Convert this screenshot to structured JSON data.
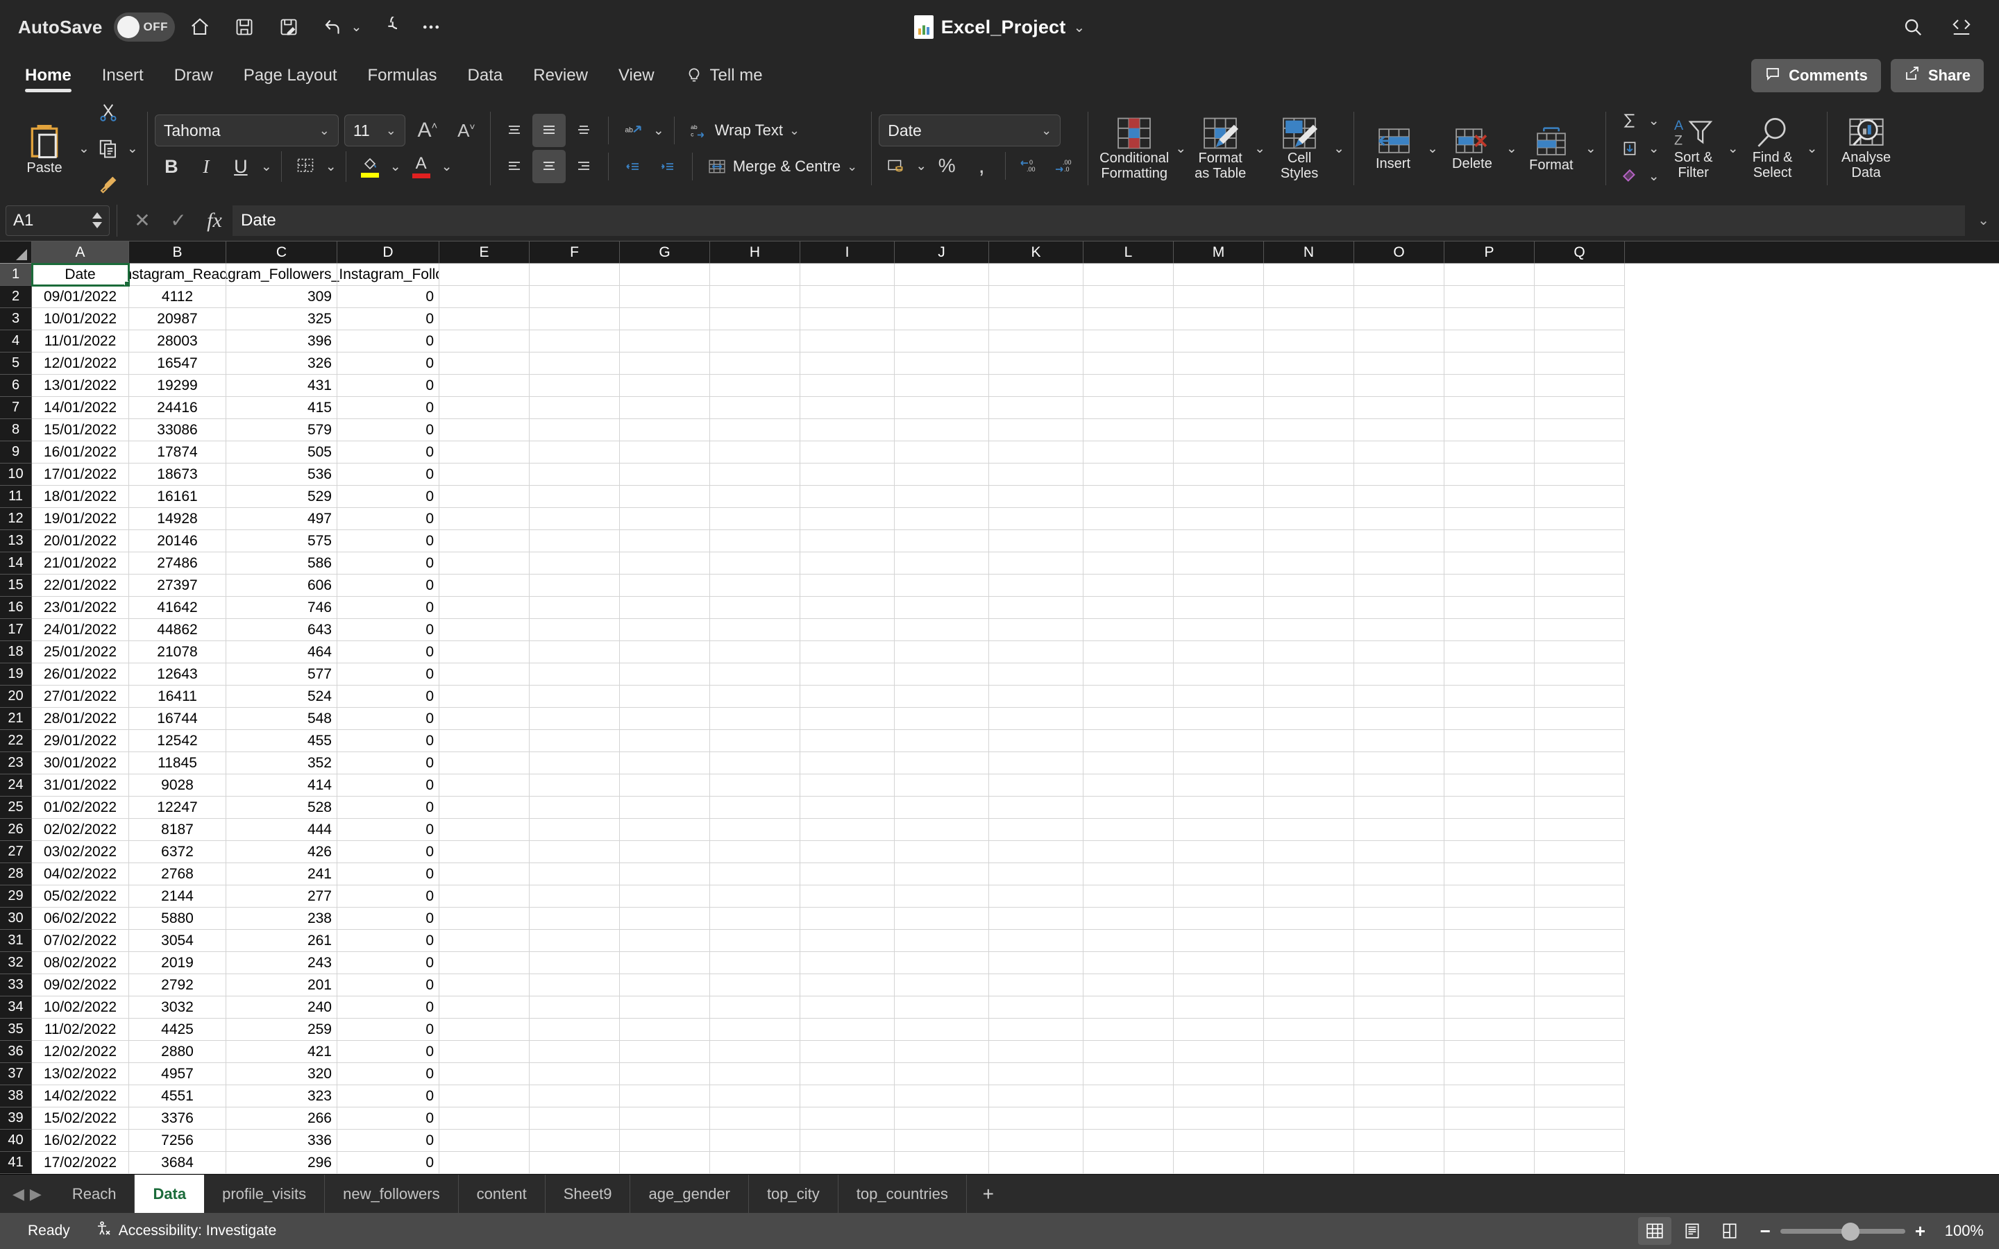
{
  "titlebar": {
    "autosave_label": "AutoSave",
    "autosave_state": "OFF",
    "document_title": "Excel_Project",
    "quick_access": [
      "home-icon",
      "save-icon",
      "save-as-icon",
      "undo-icon",
      "redo-icon",
      "more-icon"
    ],
    "right_icons": [
      "search-icon",
      "ribbon-display-icon"
    ]
  },
  "ribbon_tabs": {
    "tabs": [
      "Home",
      "Insert",
      "Draw",
      "Page Layout",
      "Formulas",
      "Data",
      "Review",
      "View"
    ],
    "active": "Home",
    "tell_me": "Tell me",
    "comments_label": "Comments",
    "share_label": "Share"
  },
  "ribbon": {
    "clipboard": {
      "paste_label": "Paste",
      "cut": "cut-icon",
      "copy": "copy-icon",
      "format_painter": "format-painter-icon"
    },
    "font": {
      "font_name": "Tahoma",
      "font_size": "11",
      "grow_label": "A",
      "shrink_label": "A",
      "bold": "B",
      "italic": "I",
      "underline": "U",
      "borders": "borders-icon",
      "fill_color": "fill-color-icon",
      "font_color": "font-color-icon",
      "fill_swatch": "#ffff00",
      "font_swatch": "#e02020"
    },
    "alignment": {
      "wrap_text": "Wrap Text",
      "merge_centre": "Merge & Centre",
      "orientation": "orientation-icon",
      "decrease_indent": "decrease-indent-icon",
      "increase_indent": "increase-indent-icon"
    },
    "number": {
      "format": "Date",
      "accounting": "accounting-icon",
      "percent": "%",
      "comma": ",",
      "increase_decimal": "increase-decimal-icon",
      "decrease_decimal": "decrease-decimal-icon"
    },
    "styles": [
      {
        "label_line1": "Conditional",
        "label_line2": "Formatting",
        "name": "conditional-formatting"
      },
      {
        "label_line1": "Format",
        "label_line2": "as Table",
        "name": "format-as-table"
      },
      {
        "label_line1": "Cell",
        "label_line2": "Styles",
        "name": "cell-styles"
      }
    ],
    "cells": [
      {
        "label_line1": "Insert",
        "label_line2": "",
        "name": "insert-cells"
      },
      {
        "label_line1": "Delete",
        "label_line2": "",
        "name": "delete-cells"
      },
      {
        "label_line1": "Format",
        "label_line2": "",
        "name": "format-cells"
      }
    ],
    "editing": {
      "autosum": "autosum-icon",
      "fill": "fill-down-icon",
      "clear": "clear-icon",
      "sort_filter_l1": "Sort &",
      "sort_filter_l2": "Filter",
      "find_select_l1": "Find &",
      "find_select_l2": "Select"
    },
    "analyse": {
      "label_line1": "Analyse",
      "label_line2": "Data"
    }
  },
  "formula_bar": {
    "name_box": "A1",
    "cancel": "cancel-icon",
    "enter": "enter-icon",
    "fx": "fx",
    "value": "Date"
  },
  "grid": {
    "columns": [
      {
        "label": "A",
        "width": 140
      },
      {
        "label": "B",
        "width": 140
      },
      {
        "label": "C",
        "width": 160
      },
      {
        "label": "D",
        "width": 147
      },
      {
        "label": "E",
        "width": 130
      },
      {
        "label": "F",
        "width": 130
      },
      {
        "label": "G",
        "width": 130
      },
      {
        "label": "H",
        "width": 130
      },
      {
        "label": "I",
        "width": 136
      },
      {
        "label": "J",
        "width": 136
      },
      {
        "label": "K",
        "width": 136
      },
      {
        "label": "L",
        "width": 130
      },
      {
        "label": "M",
        "width": 130
      },
      {
        "label": "N",
        "width": 130
      },
      {
        "label": "O",
        "width": 130
      },
      {
        "label": "P",
        "width": 130
      },
      {
        "label": "Q",
        "width": 130
      }
    ],
    "selected_column": "A",
    "selected_row": 1,
    "selected_cell": "A1",
    "header_row": [
      "Date",
      "Instagram_Reach",
      "Instagram_Followers_Visit",
      "New_Instagram_Followers"
    ],
    "rows": [
      {
        "n": 1,
        "cells": [
          "Date",
          "Instagram_Reach",
          "Instagram_Followers_Visit",
          "New_Instagram_Followers"
        ]
      },
      {
        "n": 2,
        "cells": [
          "09/01/2022",
          "4112",
          "309",
          "0"
        ]
      },
      {
        "n": 3,
        "cells": [
          "10/01/2022",
          "20987",
          "325",
          "0"
        ]
      },
      {
        "n": 4,
        "cells": [
          "11/01/2022",
          "28003",
          "396",
          "0"
        ]
      },
      {
        "n": 5,
        "cells": [
          "12/01/2022",
          "16547",
          "326",
          "0"
        ]
      },
      {
        "n": 6,
        "cells": [
          "13/01/2022",
          "19299",
          "431",
          "0"
        ]
      },
      {
        "n": 7,
        "cells": [
          "14/01/2022",
          "24416",
          "415",
          "0"
        ]
      },
      {
        "n": 8,
        "cells": [
          "15/01/2022",
          "33086",
          "579",
          "0"
        ]
      },
      {
        "n": 9,
        "cells": [
          "16/01/2022",
          "17874",
          "505",
          "0"
        ]
      },
      {
        "n": 10,
        "cells": [
          "17/01/2022",
          "18673",
          "536",
          "0"
        ]
      },
      {
        "n": 11,
        "cells": [
          "18/01/2022",
          "16161",
          "529",
          "0"
        ]
      },
      {
        "n": 12,
        "cells": [
          "19/01/2022",
          "14928",
          "497",
          "0"
        ]
      },
      {
        "n": 13,
        "cells": [
          "20/01/2022",
          "20146",
          "575",
          "0"
        ]
      },
      {
        "n": 14,
        "cells": [
          "21/01/2022",
          "27486",
          "586",
          "0"
        ]
      },
      {
        "n": 15,
        "cells": [
          "22/01/2022",
          "27397",
          "606",
          "0"
        ]
      },
      {
        "n": 16,
        "cells": [
          "23/01/2022",
          "41642",
          "746",
          "0"
        ]
      },
      {
        "n": 17,
        "cells": [
          "24/01/2022",
          "44862",
          "643",
          "0"
        ]
      },
      {
        "n": 18,
        "cells": [
          "25/01/2022",
          "21078",
          "464",
          "0"
        ]
      },
      {
        "n": 19,
        "cells": [
          "26/01/2022",
          "12643",
          "577",
          "0"
        ]
      },
      {
        "n": 20,
        "cells": [
          "27/01/2022",
          "16411",
          "524",
          "0"
        ]
      },
      {
        "n": 21,
        "cells": [
          "28/01/2022",
          "16744",
          "548",
          "0"
        ]
      },
      {
        "n": 22,
        "cells": [
          "29/01/2022",
          "12542",
          "455",
          "0"
        ]
      },
      {
        "n": 23,
        "cells": [
          "30/01/2022",
          "11845",
          "352",
          "0"
        ]
      },
      {
        "n": 24,
        "cells": [
          "31/01/2022",
          "9028",
          "414",
          "0"
        ]
      },
      {
        "n": 25,
        "cells": [
          "01/02/2022",
          "12247",
          "528",
          "0"
        ]
      },
      {
        "n": 26,
        "cells": [
          "02/02/2022",
          "8187",
          "444",
          "0"
        ]
      },
      {
        "n": 27,
        "cells": [
          "03/02/2022",
          "6372",
          "426",
          "0"
        ]
      },
      {
        "n": 28,
        "cells": [
          "04/02/2022",
          "2768",
          "241",
          "0"
        ]
      },
      {
        "n": 29,
        "cells": [
          "05/02/2022",
          "2144",
          "277",
          "0"
        ]
      },
      {
        "n": 30,
        "cells": [
          "06/02/2022",
          "5880",
          "238",
          "0"
        ]
      },
      {
        "n": 31,
        "cells": [
          "07/02/2022",
          "3054",
          "261",
          "0"
        ]
      },
      {
        "n": 32,
        "cells": [
          "08/02/2022",
          "2019",
          "243",
          "0"
        ]
      },
      {
        "n": 33,
        "cells": [
          "09/02/2022",
          "2792",
          "201",
          "0"
        ]
      },
      {
        "n": 34,
        "cells": [
          "10/02/2022",
          "3032",
          "240",
          "0"
        ]
      },
      {
        "n": 35,
        "cells": [
          "11/02/2022",
          "4425",
          "259",
          "0"
        ]
      },
      {
        "n": 36,
        "cells": [
          "12/02/2022",
          "2880",
          "421",
          "0"
        ]
      },
      {
        "n": 37,
        "cells": [
          "13/02/2022",
          "4957",
          "320",
          "0"
        ]
      },
      {
        "n": 38,
        "cells": [
          "14/02/2022",
          "4551",
          "323",
          "0"
        ]
      },
      {
        "n": 39,
        "cells": [
          "15/02/2022",
          "3376",
          "266",
          "0"
        ]
      },
      {
        "n": 40,
        "cells": [
          "16/02/2022",
          "7256",
          "336",
          "0"
        ]
      },
      {
        "n": 41,
        "cells": [
          "17/02/2022",
          "3684",
          "296",
          "0"
        ]
      }
    ]
  },
  "sheet_tabs": {
    "tabs": [
      "Reach",
      "Data",
      "profile_visits",
      "new_followers",
      "content",
      "Sheet9",
      "age_gender",
      "top_city",
      "top_countries"
    ],
    "active": "Data",
    "add_label": "+"
  },
  "status_bar": {
    "status": "Ready",
    "accessibility": "Accessibility: Investigate",
    "views": [
      "normal-view-icon",
      "page-layout-icon",
      "page-break-icon"
    ],
    "active_view": "normal-view-icon",
    "zoom_out": "−",
    "zoom_in": "+",
    "zoom_level": "100%"
  }
}
